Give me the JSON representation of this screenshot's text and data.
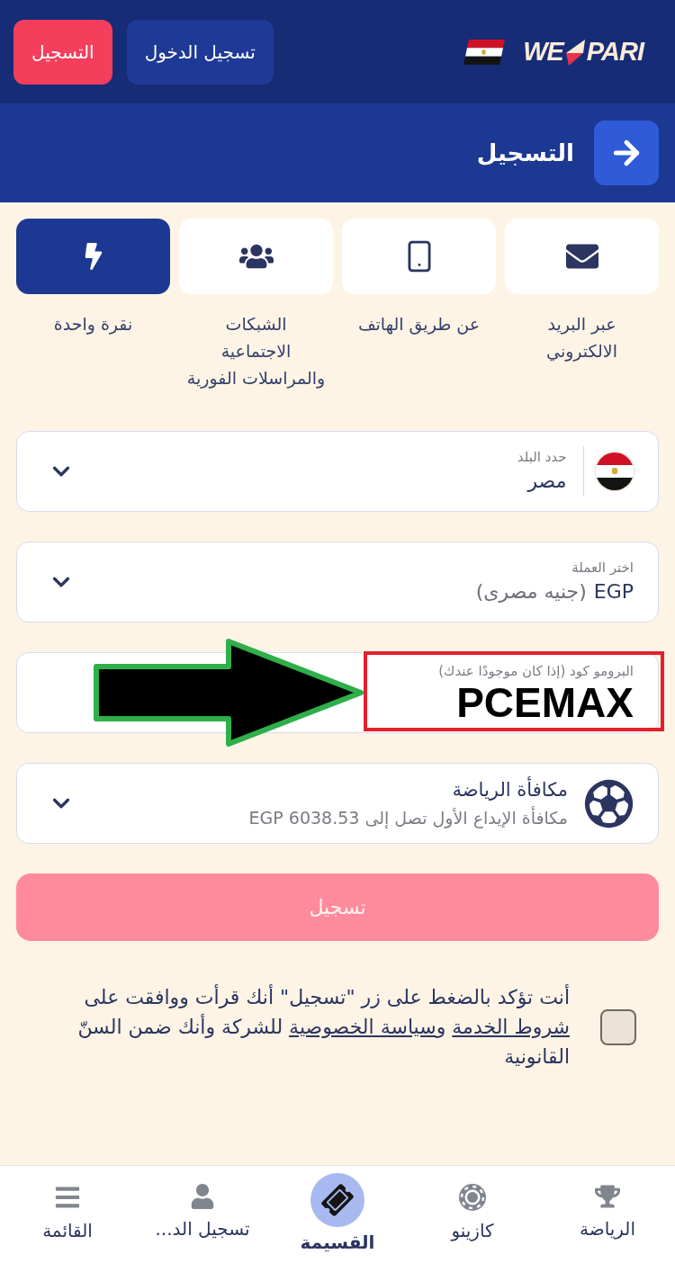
{
  "header": {
    "logo": {
      "left": "WE",
      "right": "PARI"
    },
    "login_button": "تسجيل الدخول",
    "register_button": "التسجيل"
  },
  "page_header": {
    "title": "التسجيل"
  },
  "methods": [
    {
      "kind": "email",
      "label": "عبر البريد\nالالكتروني",
      "selected": false
    },
    {
      "kind": "phone",
      "label": "عن طريق الهاتف",
      "selected": false
    },
    {
      "kind": "social",
      "label": "الشبكات\nالاجتماعية\nوالمراسلات الفورية",
      "selected": false
    },
    {
      "kind": "one_click",
      "label": "نقرة واحدة",
      "selected": true
    }
  ],
  "form": {
    "country": {
      "label": "حدد البلد",
      "value": "مصر"
    },
    "currency": {
      "label": "اختر العملة",
      "value": "EGP",
      "note": "(جنيه مصرى)"
    },
    "promo_code": {
      "label": "البرومو كود (إذا كان موجودًا عندك)",
      "value": "PCEMAX"
    },
    "bonus": {
      "title": "مكافأة الرياضة",
      "subtitle": "مكافأة الإيداع الأول تصل إلى EGP 6038.53"
    }
  },
  "submit": {
    "label": "تسجيل",
    "disabled": true
  },
  "consent": {
    "checked": false,
    "parts": [
      {
        "kind": "text",
        "text": "أنت تؤكد بالضغط على زر \"تسجيل\" أنك قرأت ووافقت على "
      },
      {
        "kind": "link",
        "text": "شروط الخدمة"
      },
      {
        "kind": "text",
        "text": " و"
      },
      {
        "kind": "link",
        "text": "سياسة الخصوصية"
      },
      {
        "kind": "text",
        "text": " للشركة وأنك ضمن السنّ القانونية"
      }
    ]
  },
  "bottom_nav": {
    "items": [
      {
        "kind": "sports",
        "label": "الرياضة",
        "selected": false
      },
      {
        "kind": "casino",
        "label": "كازينو",
        "selected": false
      },
      {
        "kind": "coupon",
        "label": "القسيمة",
        "selected": true
      },
      {
        "kind": "login",
        "label": "تسجيل الد...",
        "selected": false
      },
      {
        "kind": "menu",
        "label": "القائمة",
        "selected": false
      }
    ]
  }
}
